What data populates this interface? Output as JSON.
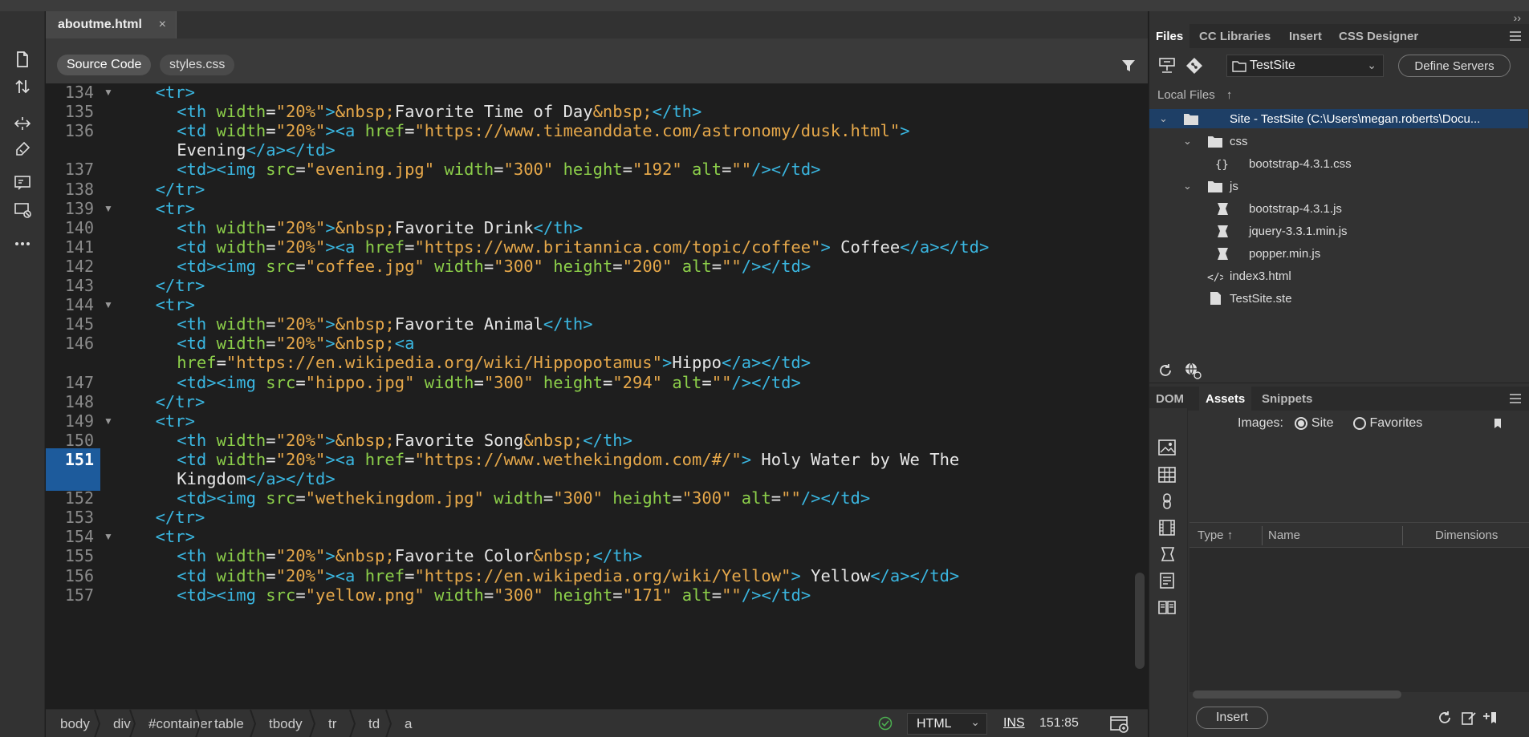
{
  "document": {
    "tab_label": "aboutme.html",
    "tab_close": "×",
    "related_files": [
      "Source Code",
      "styles.css"
    ]
  },
  "code_lines": [
    {
      "num": "134",
      "fold": true,
      "indent": 2,
      "html": "<span class=\"t\">&lt;tr&gt;</span>"
    },
    {
      "num": "135",
      "fold": false,
      "indent": 4,
      "html": "<span class=\"t\">&lt;th</span> <span class=\"a\">width</span>=<span class=\"v\">\"20%\"</span><span class=\"t\">&gt;</span><span class=\"e\">&amp;nbsp;</span>Favorite Time of Day<span class=\"e\">&amp;nbsp;</span><span class=\"t\">&lt;/th&gt;</span>"
    },
    {
      "num": "136",
      "fold": false,
      "indent": 4,
      "html": "<span class=\"t\">&lt;td</span> <span class=\"a\">width</span>=<span class=\"v\">\"20%\"</span><span class=\"t\">&gt;&lt;a</span> <span class=\"a\">href</span>=<span class=\"v\">\"https://www.timeanddate.com/astronomy/dusk.html\"</span><span class=\"t\">&gt;</span>"
    },
    {
      "num": "",
      "fold": false,
      "indent": 4,
      "html": "Evening<span class=\"t\">&lt;/a&gt;&lt;/td&gt;</span>"
    },
    {
      "num": "137",
      "fold": false,
      "indent": 4,
      "html": "<span class=\"t\">&lt;td&gt;&lt;img</span> <span class=\"a\">src</span>=<span class=\"v\">\"evening.jpg\"</span> <span class=\"a\">width</span>=<span class=\"v\">\"300\"</span> <span class=\"a\">height</span>=<span class=\"v\">\"192\"</span> <span class=\"a\">alt</span>=<span class=\"v\">\"\"</span><span class=\"t\">/&gt;&lt;/td&gt;</span>"
    },
    {
      "num": "138",
      "fold": false,
      "indent": 2,
      "html": "<span class=\"t\">&lt;/tr&gt;</span>"
    },
    {
      "num": "139",
      "fold": true,
      "indent": 2,
      "html": "<span class=\"t\">&lt;tr&gt;</span>"
    },
    {
      "num": "140",
      "fold": false,
      "indent": 4,
      "html": "<span class=\"t\">&lt;th</span> <span class=\"a\">width</span>=<span class=\"v\">\"20%\"</span><span class=\"t\">&gt;</span><span class=\"e\">&amp;nbsp;</span>Favorite Drink<span class=\"t\">&lt;/th&gt;</span>"
    },
    {
      "num": "141",
      "fold": false,
      "indent": 4,
      "html": "<span class=\"t\">&lt;td</span> <span class=\"a\">width</span>=<span class=\"v\">\"20%\"</span><span class=\"t\">&gt;&lt;a</span> <span class=\"a\">href</span>=<span class=\"v\">\"https://www.britannica.com/topic/coffee\"</span><span class=\"t\">&gt;</span> Coffee<span class=\"t\">&lt;/a&gt;&lt;/td&gt;</span>"
    },
    {
      "num": "142",
      "fold": false,
      "indent": 4,
      "html": "<span class=\"t\">&lt;td&gt;&lt;img</span> <span class=\"a\">src</span>=<span class=\"v\">\"coffee.jpg\"</span> <span class=\"a\">width</span>=<span class=\"v\">\"300\"</span> <span class=\"a\">height</span>=<span class=\"v\">\"200\"</span> <span class=\"a\">alt</span>=<span class=\"v\">\"\"</span><span class=\"t\">/&gt;&lt;/td&gt;</span>"
    },
    {
      "num": "143",
      "fold": false,
      "indent": 2,
      "html": "<span class=\"t\">&lt;/tr&gt;</span>"
    },
    {
      "num": "144",
      "fold": true,
      "indent": 2,
      "html": "<span class=\"t\">&lt;tr&gt;</span>"
    },
    {
      "num": "145",
      "fold": false,
      "indent": 4,
      "html": "<span class=\"t\">&lt;th</span> <span class=\"a\">width</span>=<span class=\"v\">\"20%\"</span><span class=\"t\">&gt;</span><span class=\"e\">&amp;nbsp;</span>Favorite Animal<span class=\"t\">&lt;/th&gt;</span>"
    },
    {
      "num": "146",
      "fold": false,
      "indent": 4,
      "html": "<span class=\"t\">&lt;td</span> <span class=\"a\">width</span>=<span class=\"v\">\"20%\"</span><span class=\"t\">&gt;</span><span class=\"e\">&amp;nbsp;</span><span class=\"t\">&lt;a</span>"
    },
    {
      "num": "",
      "fold": false,
      "indent": 4,
      "html": "<span class=\"a\">href</span>=<span class=\"v\">\"https://en.wikipedia.org/wiki/Hippopotamus\"</span><span class=\"t\">&gt;</span>Hippo<span class=\"t\">&lt;/a&gt;&lt;/td&gt;</span>"
    },
    {
      "num": "147",
      "fold": false,
      "indent": 4,
      "html": "<span class=\"t\">&lt;td&gt;&lt;img</span> <span class=\"a\">src</span>=<span class=\"v\">\"hippo.jpg\"</span> <span class=\"a\">width</span>=<span class=\"v\">\"300\"</span> <span class=\"a\">height</span>=<span class=\"v\">\"294\"</span> <span class=\"a\">alt</span>=<span class=\"v\">\"\"</span><span class=\"t\">/&gt;&lt;/td&gt;</span>"
    },
    {
      "num": "148",
      "fold": false,
      "indent": 2,
      "html": "<span class=\"t\">&lt;/tr&gt;</span>"
    },
    {
      "num": "149",
      "fold": true,
      "indent": 2,
      "html": "<span class=\"t\">&lt;tr&gt;</span>"
    },
    {
      "num": "150",
      "fold": false,
      "indent": 4,
      "html": "<span class=\"t\">&lt;th</span> <span class=\"a\">width</span>=<span class=\"v\">\"20%\"</span><span class=\"t\">&gt;</span><span class=\"e\">&amp;nbsp;</span>Favorite Song<span class=\"e\">&amp;nbsp;</span><span class=\"t\">&lt;/th&gt;</span>"
    },
    {
      "num": "151",
      "fold": false,
      "indent": 4,
      "current": true,
      "html": "<span class=\"t\">&lt;td</span> <span class=\"a\">width</span>=<span class=\"v\">\"20%\"</span><span class=\"t\">&gt;&lt;a</span> <span class=\"a\">href</span>=<span class=\"v\">\"https://www.wethekingdom.com/#/\"</span><span class=\"t\">&gt;</span> Holy Water by We The"
    },
    {
      "num": "",
      "fold": false,
      "indent": 4,
      "current": true,
      "html": "Kingdom<span class=\"t\">&lt;/a&gt;&lt;/td&gt;</span>"
    },
    {
      "num": "152",
      "fold": false,
      "indent": 4,
      "html": "<span class=\"t\">&lt;td&gt;&lt;img</span> <span class=\"a\">src</span>=<span class=\"v\">\"wethekingdom.jpg\"</span> <span class=\"a\">width</span>=<span class=\"v\">\"300\"</span> <span class=\"a\">height</span>=<span class=\"v\">\"300\"</span> <span class=\"a\">alt</span>=<span class=\"v\">\"\"</span><span class=\"t\">/&gt;&lt;/td&gt;</span>"
    },
    {
      "num": "153",
      "fold": false,
      "indent": 2,
      "html": "<span class=\"t\">&lt;/tr&gt;</span>"
    },
    {
      "num": "154",
      "fold": true,
      "indent": 2,
      "html": "<span class=\"t\">&lt;tr&gt;</span>"
    },
    {
      "num": "155",
      "fold": false,
      "indent": 4,
      "html": "<span class=\"t\">&lt;th</span> <span class=\"a\">width</span>=<span class=\"v\">\"20%\"</span><span class=\"t\">&gt;</span><span class=\"e\">&amp;nbsp;</span>Favorite Color<span class=\"e\">&amp;nbsp;</span><span class=\"t\">&lt;/th&gt;</span>"
    },
    {
      "num": "156",
      "fold": false,
      "indent": 4,
      "html": "<span class=\"t\">&lt;td</span> <span class=\"a\">width</span>=<span class=\"v\">\"20%\"</span><span class=\"t\">&gt;&lt;a</span> <span class=\"a\">href</span>=<span class=\"v\">\"https://en.wikipedia.org/wiki/Yellow\"</span><span class=\"t\">&gt;</span> Yellow<span class=\"t\">&lt;/a&gt;&lt;/td&gt;</span>"
    },
    {
      "num": "157",
      "fold": false,
      "indent": 4,
      "html": "<span class=\"t\">&lt;td&gt;&lt;img</span> <span class=\"a\">src</span>=<span class=\"v\">\"yellow.png\"</span> <span class=\"a\">width</span>=<span class=\"v\">\"300\"</span> <span class=\"a\">height</span>=<span class=\"v\">\"171\"</span> <span class=\"a\">alt</span>=<span class=\"v\">\"\"</span><span class=\"t\">/&gt;&lt;/td&gt;</span>"
    }
  ],
  "status": {
    "breadcrumbs": [
      "body",
      "div",
      "#container",
      "table",
      "tbody",
      "tr",
      "td",
      "a"
    ],
    "language": "HTML",
    "insert_mode": "INS",
    "cursor_position": "151:85"
  },
  "files_panel": {
    "tabs": [
      "Files",
      "CC Libraries",
      "Insert",
      "CSS Designer"
    ],
    "site_name": "TestSite",
    "define_servers": "Define Servers",
    "local_files_label": "Local Files",
    "tree": [
      {
        "label": "Site - TestSite (C:\\Users\\megan.roberts\\Docu...",
        "icon": "folder-icon",
        "toggle": "⌄",
        "selected": true
      },
      {
        "label": "css",
        "icon": "folder-icon",
        "toggle": "⌄"
      },
      {
        "label": "bootstrap-4.3.1.css",
        "icon": "css-file-icon"
      },
      {
        "label": "js",
        "icon": "folder-icon",
        "toggle": "⌄"
      },
      {
        "label": "bootstrap-4.3.1.js",
        "icon": "js-file-icon"
      },
      {
        "label": "jquery-3.3.1.min.js",
        "icon": "js-file-icon"
      },
      {
        "label": "popper.min.js",
        "icon": "js-file-icon"
      },
      {
        "label": "index3.html",
        "icon": "html-file-icon"
      },
      {
        "label": "TestSite.ste",
        "icon": "file-icon"
      }
    ]
  },
  "assets_panel": {
    "tabs": [
      "DOM",
      "Assets",
      "Snippets"
    ],
    "images_label": "Images:",
    "radio_site": "Site",
    "radio_favorites": "Favorites",
    "columns": [
      "Type",
      "Name",
      "Dimensions"
    ],
    "insert_label": "Insert"
  },
  "colors": {
    "tag": "#3ab6e0",
    "attribute": "#8ccf4a",
    "value": "#e6a84a",
    "current_line": "#1d5b9c",
    "selection": "#1e3f66"
  }
}
